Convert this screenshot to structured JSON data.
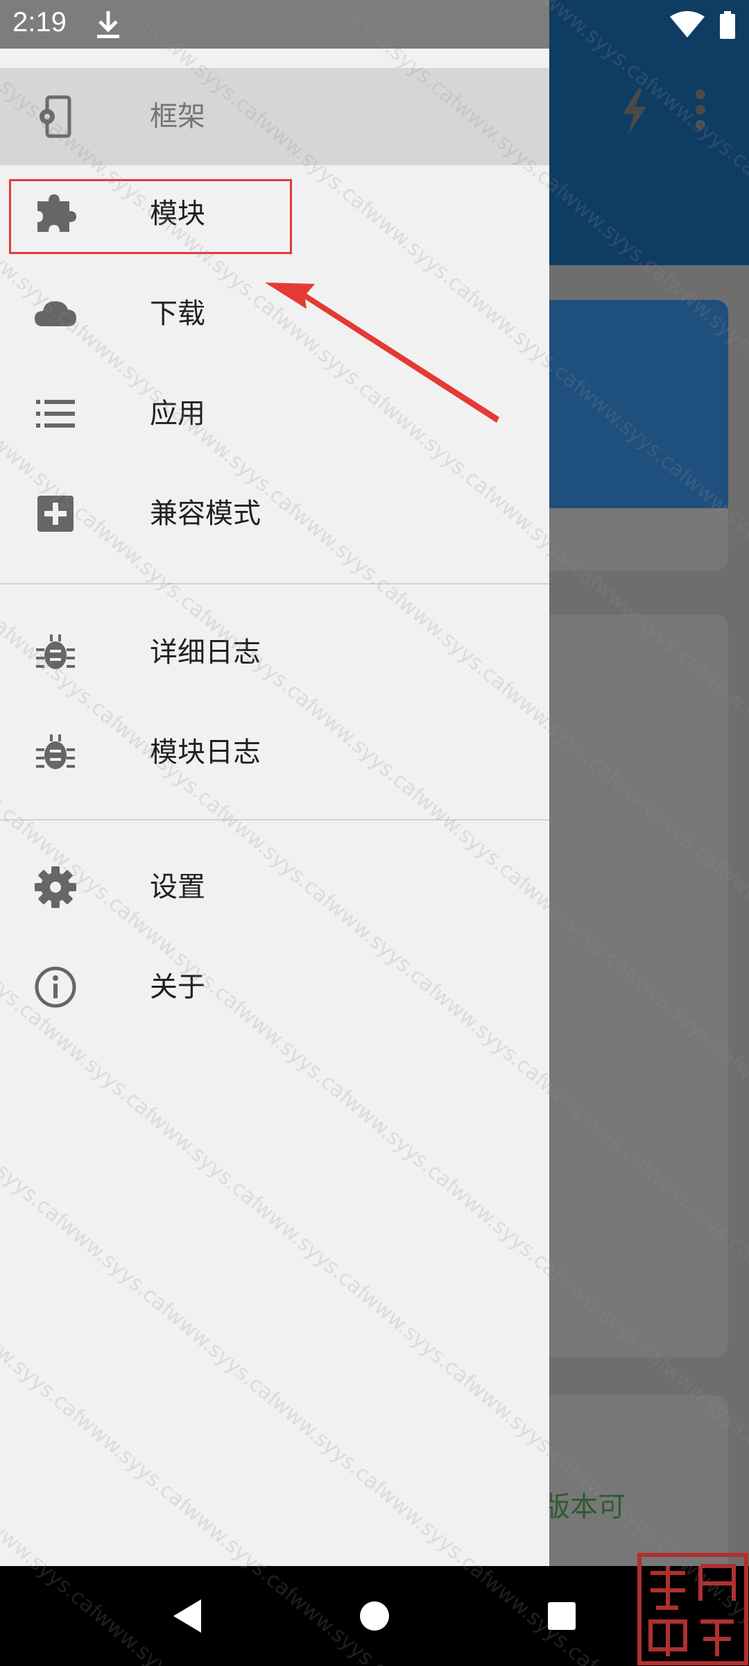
{
  "status_bar": {
    "time": "2:19",
    "download_icon": "download-icon",
    "wifi_icon": "wifi-icon",
    "battery_icon": "battery-icon"
  },
  "drawer": {
    "items": [
      {
        "label": "框架",
        "icon": "phone-settings-icon",
        "selected": true
      },
      {
        "label": "模块",
        "icon": "puzzle-icon",
        "selected": false
      },
      {
        "label": "下载",
        "icon": "cloud-icon",
        "selected": false
      },
      {
        "label": "应用",
        "icon": "list-icon",
        "selected": false
      },
      {
        "label": "兼容模式",
        "icon": "plus-box-icon",
        "selected": false
      },
      {
        "label": "详细日志",
        "icon": "bug-icon",
        "selected": false
      },
      {
        "label": "模块日志",
        "icon": "bug-icon",
        "selected": false
      },
      {
        "label": "设置",
        "icon": "gear-icon",
        "selected": false
      },
      {
        "label": "关于",
        "icon": "info-icon",
        "selected": false
      }
    ]
  },
  "background": {
    "partial_text": "版本可",
    "toolbar_icons": [
      "flash-icon",
      "more-vert-icon"
    ]
  },
  "watermark": {
    "text": "www.syys.cafe"
  },
  "colors": {
    "drawer_bg": "#f1f1f1",
    "selected_bg": "#d6d6d6",
    "toolbar": "#0f3c63",
    "highlight": "#e23a3a",
    "icon": "#666666"
  }
}
